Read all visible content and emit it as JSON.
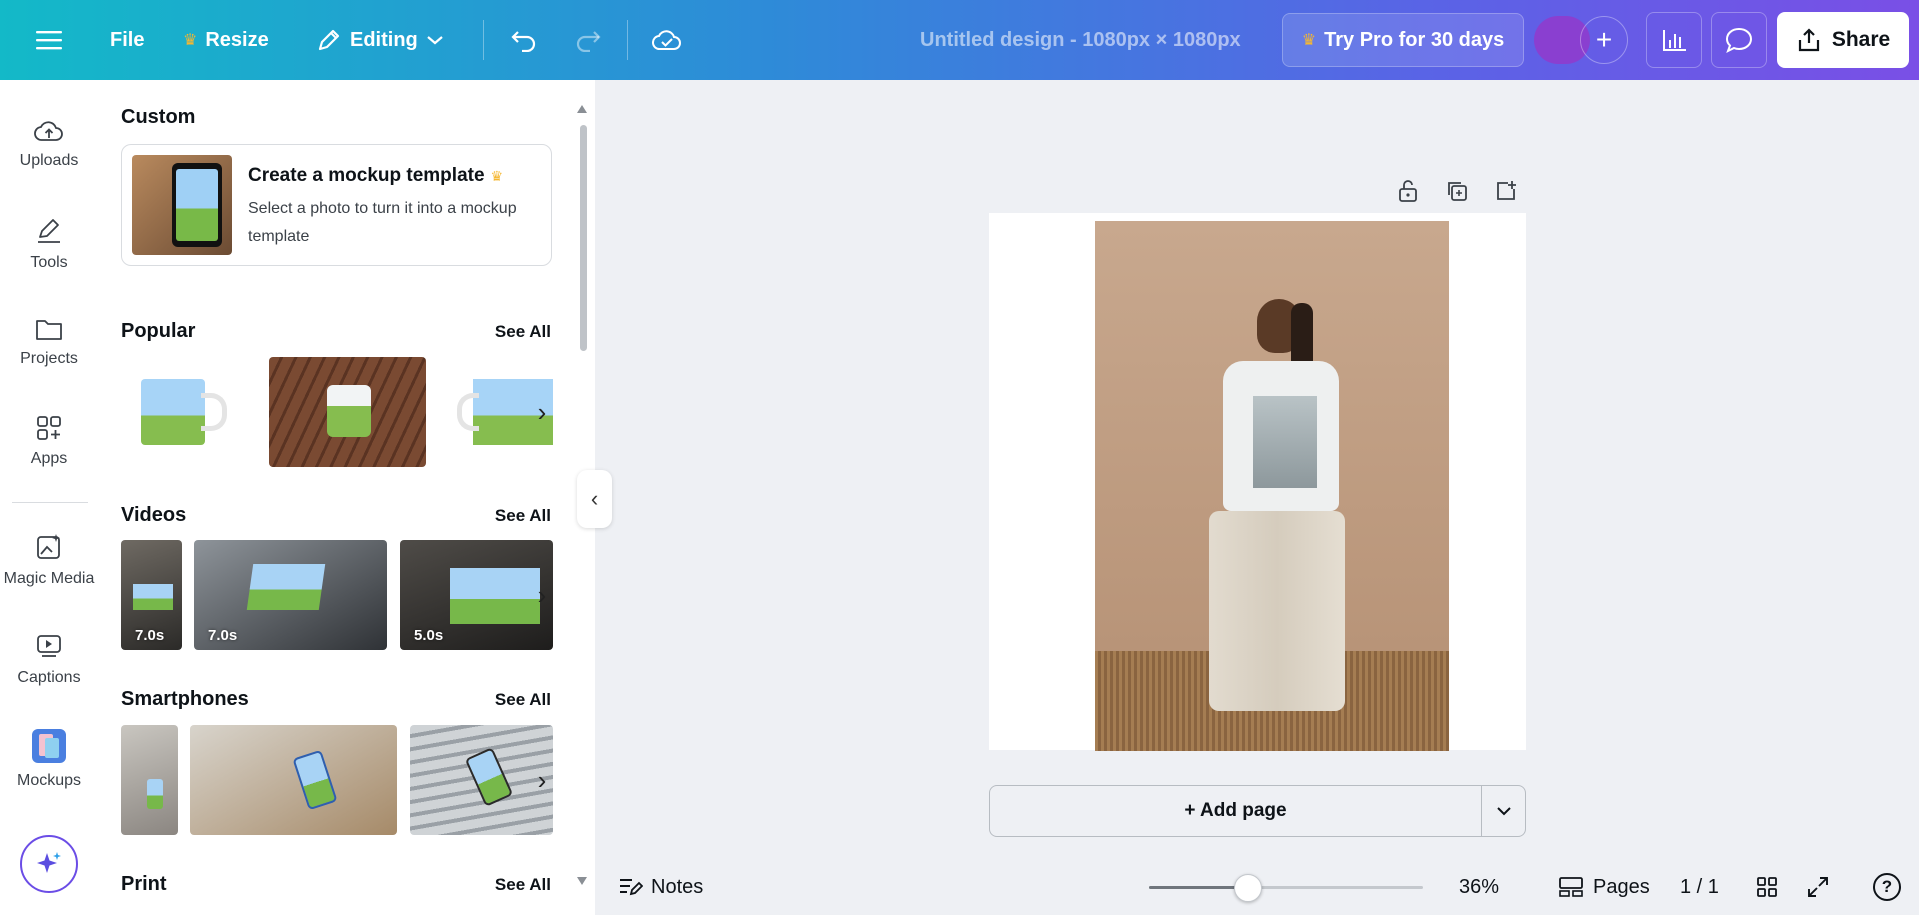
{
  "header": {
    "file_label": "File",
    "resize_label": "Resize",
    "editing_label": "Editing",
    "design_title": "Untitled design - 1080px × 1080px",
    "try_pro_label": "Try Pro for 30 days",
    "share_label": "Share"
  },
  "rail": {
    "items": [
      {
        "label": "Uploads",
        "icon": "cloud-upload-icon"
      },
      {
        "label": "Tools",
        "icon": "pen-icon"
      },
      {
        "label": "Projects",
        "icon": "folder-icon"
      },
      {
        "label": "Apps",
        "icon": "apps-grid-icon"
      },
      {
        "label": "Magic Media",
        "icon": "magic-media-icon"
      },
      {
        "label": "Captions",
        "icon": "captions-icon"
      },
      {
        "label": "Mockups",
        "icon": "mockups-icon"
      }
    ]
  },
  "panel": {
    "custom_title": "Custom",
    "custom_card": {
      "title": "Create a mockup template",
      "description": "Select a photo to turn it into a mockup template"
    },
    "popular_title": "Popular",
    "videos_title": "Videos",
    "smartphones_title": "Smartphones",
    "print_title": "Print",
    "see_all": "See All",
    "video_durations": [
      "7.0s",
      "7.0s",
      "5.0s"
    ]
  },
  "footer": {
    "add_page_label": "+ Add page",
    "notes_label": "Notes",
    "zoom_value": "36%",
    "zoom_fraction": 0.36,
    "pages_label": "Pages",
    "page_count": "1 / 1",
    "help_label": "?"
  },
  "colors": {
    "topbar_start": "#13b9c8",
    "topbar_end": "#7a4fe6",
    "pro_crown": "#f5b731",
    "canvas_bg": "#eef0f4"
  }
}
